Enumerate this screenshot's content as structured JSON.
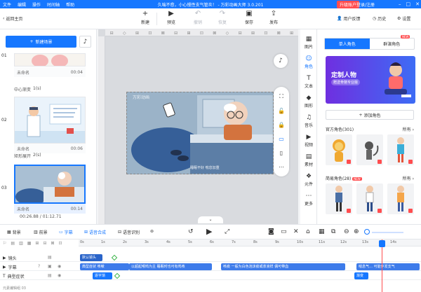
{
  "titlebar": {
    "menu": [
      "文件",
      "编辑",
      "操作",
      "时间轴",
      "帮助"
    ],
    "title": "久喘不愈，小心慢性支气管炎！ - 万彩动画大师 3.0.201",
    "upgrade": "升级账户",
    "login": "登录/注册"
  },
  "toolbar": {
    "back": "返回主页",
    "new": "新建",
    "preview": "预览",
    "undo": "撤销",
    "redo": "恢复",
    "save": "保存",
    "publish": "发布",
    "feedback": "用户反馈",
    "history": "历史",
    "settings": "设置"
  },
  "scenes": {
    "new_scene": "新建场景",
    "items": [
      {
        "num": "01",
        "name": "未命名",
        "time": "00:04"
      },
      {
        "num": "02",
        "name": "未命名",
        "time": "00:06"
      },
      {
        "num": "03",
        "name": "未命名",
        "time": "00:14"
      }
    ],
    "transitions": [
      {
        "label": "中心渐变",
        "dur": "1(s)"
      },
      {
        "label": "矩形展开",
        "dur": "2(s)"
      }
    ],
    "current_time": "00:26.88",
    "total_time": "/ 01:12.71"
  },
  "stage": {
    "watermark": "万彩动画",
    "subtitle": "睡眠不好 喘息加重"
  },
  "vtabs": [
    "图片",
    "角色",
    "文本",
    "图形",
    "音乐",
    "视频",
    "素材",
    "元件",
    "更多"
  ],
  "roles": {
    "tab_single": "单人角色",
    "tab_group": "群演角色",
    "new_badge": "NEW",
    "banner_title": "定制人物",
    "banner_sub": "赠送骨骼专业版",
    "add_role": "添加角色",
    "official": "官方角色(301)",
    "simple": "简易角色(28)",
    "all": "所有",
    "new_badge2": "NEW"
  },
  "proptoolbar": {
    "bg": "背景",
    "fg": "前景",
    "subtitle": "字幕",
    "tts": "语音合成",
    "asr": "语音识别"
  },
  "timeline": {
    "ticks": [
      "0s",
      "1s",
      "2s",
      "3s",
      "4s",
      "5s",
      "6s",
      "7s",
      "8s",
      "9s",
      "10s",
      "11s",
      "12s",
      "13s",
      "14s"
    ],
    "tracks": [
      {
        "label": "镜头",
        "clip": "默认镜头"
      },
      {
        "label": "字幕",
        "clips": [
          "典型症状 咳嗽",
          "以超起喉鸣为主 睡眠时也可有鸣咳",
          "咳痰 一般为白色泡沫痰或浆液样 偶可带血",
          "喘息气… 可能伴发支气"
        ]
      },
      {
        "label": "典型症状",
        "clip": "逐字渐",
        "clip2": "渐变"
      }
    ],
    "footer": "元素编辑组 03"
  }
}
